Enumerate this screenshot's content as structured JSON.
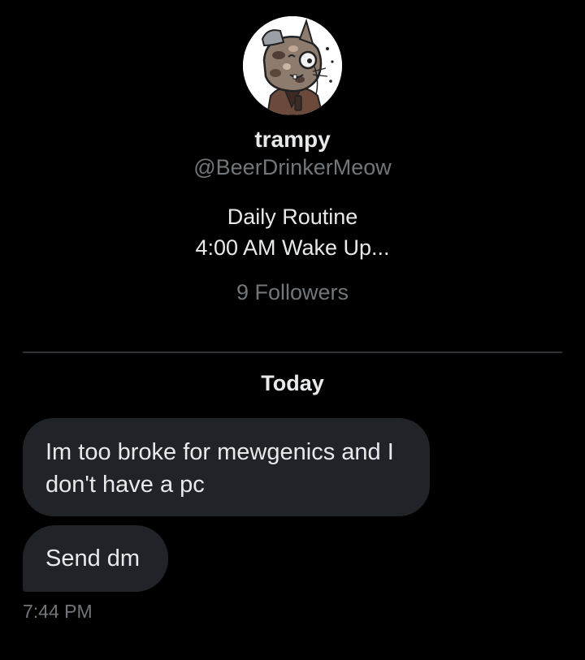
{
  "profile": {
    "display_name": "trampy",
    "handle": "@BeerDrinkerMeow",
    "bio_line_1": "Daily Routine",
    "bio_line_2": "4:00 AM Wake Up...",
    "followers": "9 Followers"
  },
  "conversation": {
    "date_separator": "Today",
    "messages": [
      {
        "text": "Im too broke for mewgenics and I don't have a pc"
      },
      {
        "text": "Send dm"
      }
    ],
    "timestamp": "7:44 PM"
  },
  "colors": {
    "background": "#000000",
    "primary_text": "#e7e9ea",
    "secondary_text": "#71767b",
    "bubble": "#202327",
    "divider": "#2f3336"
  }
}
